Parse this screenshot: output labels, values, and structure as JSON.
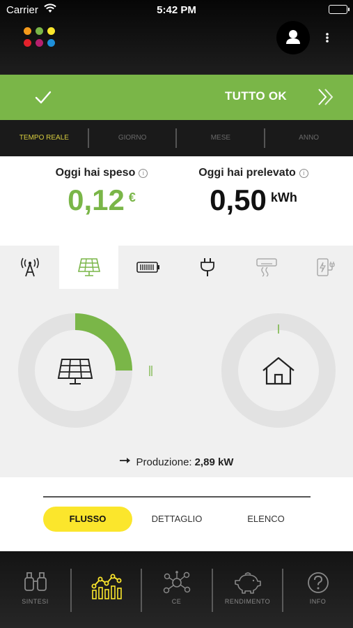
{
  "status_bar": {
    "carrier": "Carrier",
    "time": "5:42 PM"
  },
  "header": {
    "logo_dot_colors": [
      "#f59a1b",
      "#7ab648",
      "#fbe62c",
      "#e3212b",
      "#b6206d",
      "#1e8fd9"
    ]
  },
  "banner": {
    "status_label": "TUTTO OK",
    "color": "#7ab648"
  },
  "periods": {
    "active_color": "#d8cd3f",
    "items": [
      {
        "label": "TEMPO REALE",
        "active": true
      },
      {
        "label": "GIORNO",
        "active": false
      },
      {
        "label": "MESE",
        "active": false
      },
      {
        "label": "ANNO",
        "active": false
      }
    ]
  },
  "summary": {
    "spent": {
      "caption": "Oggi hai speso",
      "value": "0,12",
      "unit": "€",
      "color": "#7ab648"
    },
    "drawn": {
      "caption": "Oggi hai prelevato",
      "value": "0,50",
      "unit": "kWh",
      "color": "#111111"
    }
  },
  "categories": [
    {
      "icon": "antenna-icon",
      "active": false
    },
    {
      "icon": "solar-panel-icon",
      "active": true
    },
    {
      "icon": "battery-icon",
      "active": false
    },
    {
      "icon": "plug-icon",
      "active": false
    },
    {
      "icon": "air-conditioner-icon",
      "active": false
    },
    {
      "icon": "ev-charger-icon",
      "active": false
    }
  ],
  "flow": {
    "production_label": "Produzione:",
    "production_value": "2,89 kW",
    "solar_ring_fill": 0.25,
    "ring_color": "#7ab648"
  },
  "view_toggle": {
    "items": [
      {
        "label": "FLUSSO",
        "active": true
      },
      {
        "label": "DETTAGLIO",
        "active": false
      },
      {
        "label": "ELENCO",
        "active": false
      }
    ]
  },
  "bottom_nav": {
    "active_color": "#fbe62c",
    "items": [
      {
        "label": "SINTESI",
        "icon": "binoculars-icon",
        "active": false
      },
      {
        "label": "",
        "icon": "chart-icon",
        "active": true
      },
      {
        "label": "CE",
        "icon": "network-icon",
        "active": false
      },
      {
        "label": "RENDIMENTO",
        "icon": "piggy-bank-icon",
        "active": false
      },
      {
        "label": "INFO",
        "icon": "help-icon",
        "active": false
      }
    ]
  }
}
